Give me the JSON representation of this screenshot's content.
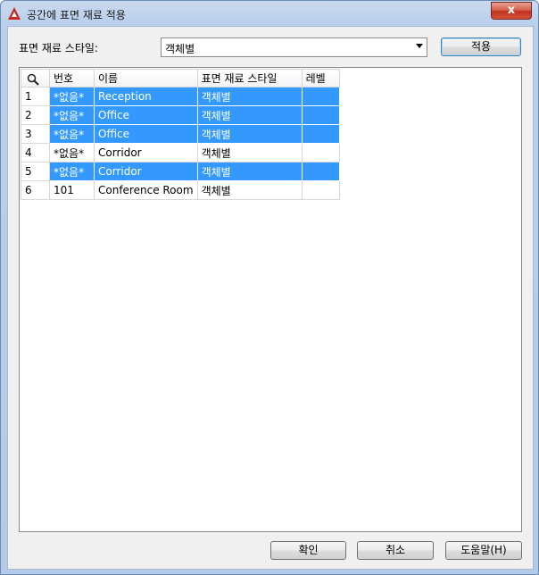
{
  "window": {
    "title": "공간에 표면 재료 적용",
    "close_glyph": "x"
  },
  "style": {
    "label": "표면 재료 스타일:",
    "selected": "객체별"
  },
  "buttons": {
    "apply": "적용",
    "ok": "확인",
    "cancel": "취소",
    "help": "도움말(H)"
  },
  "grid": {
    "columns": [
      "번호",
      "이름",
      "표면 재료 스타일",
      "레벨"
    ],
    "rows": [
      {
        "index": "1",
        "number": "*없음*",
        "name": "Reception",
        "style": "객체별",
        "level": "",
        "selected": true
      },
      {
        "index": "2",
        "number": "*없음*",
        "name": "Office",
        "style": "객체별",
        "level": "",
        "selected": true
      },
      {
        "index": "3",
        "number": "*없음*",
        "name": "Office",
        "style": "객체별",
        "level": "",
        "selected": true
      },
      {
        "index": "4",
        "number": "*없음*",
        "name": "Corridor",
        "style": "객체별",
        "level": "",
        "selected": false
      },
      {
        "index": "5",
        "number": "*없음*",
        "name": "Corridor",
        "style": "객체별",
        "level": "",
        "selected": true
      },
      {
        "index": "6",
        "number": "101",
        "name": "Conference Room",
        "style": "객체별",
        "level": "",
        "selected": false
      }
    ]
  },
  "colors": {
    "selection": "#3399ff",
    "app_icon": "#c8271b"
  }
}
